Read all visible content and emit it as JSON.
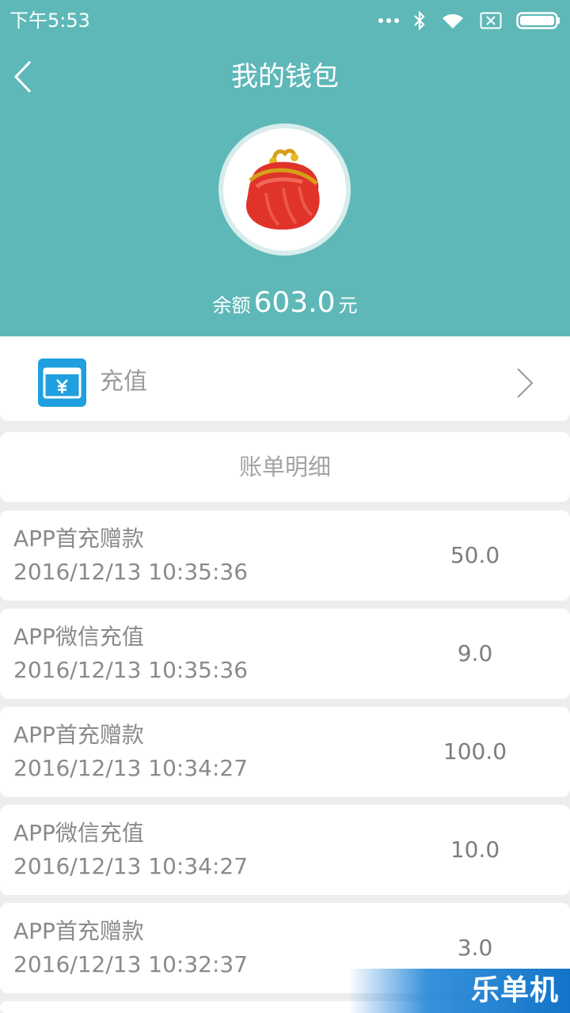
{
  "status_bar": {
    "time": "下午5:53",
    "icons": [
      "more-dots-icon",
      "bluetooth-icon",
      "wifi-icon",
      "sim-off-icon",
      "battery-icon"
    ]
  },
  "nav": {
    "title": "我的钱包",
    "back_icon": "chevron-left-icon"
  },
  "wallet": {
    "icon": "red-purse-icon",
    "balance_label": "余额",
    "balance_amount": "603.0",
    "balance_unit": "元"
  },
  "recharge": {
    "icon": "yuan-card-icon",
    "label": "充值",
    "chevron": "chevron-right-icon"
  },
  "bills": {
    "header": "账单明细",
    "records": [
      {
        "title": "APP首充赠款",
        "time": "2016/12/13 10:35:36",
        "amount": "50.0"
      },
      {
        "title": "APP微信充值",
        "time": "2016/12/13 10:35:36",
        "amount": "9.0"
      },
      {
        "title": "APP首充赠款",
        "time": "2016/12/13 10:34:27",
        "amount": "100.0"
      },
      {
        "title": "APP微信充值",
        "time": "2016/12/13 10:34:27",
        "amount": "10.0"
      },
      {
        "title": "APP首充赠款",
        "time": "2016/12/13 10:32:37",
        "amount": "3.0"
      }
    ]
  },
  "watermark": {
    "text": "乐单机"
  },
  "colors": {
    "header_bg": "#5fb8b8",
    "page_bg": "#ededed",
    "recharge_icon_bg": "#1f9fdf",
    "text_gray": "#8a8a8a",
    "watermark_blue": "#1273c8"
  }
}
